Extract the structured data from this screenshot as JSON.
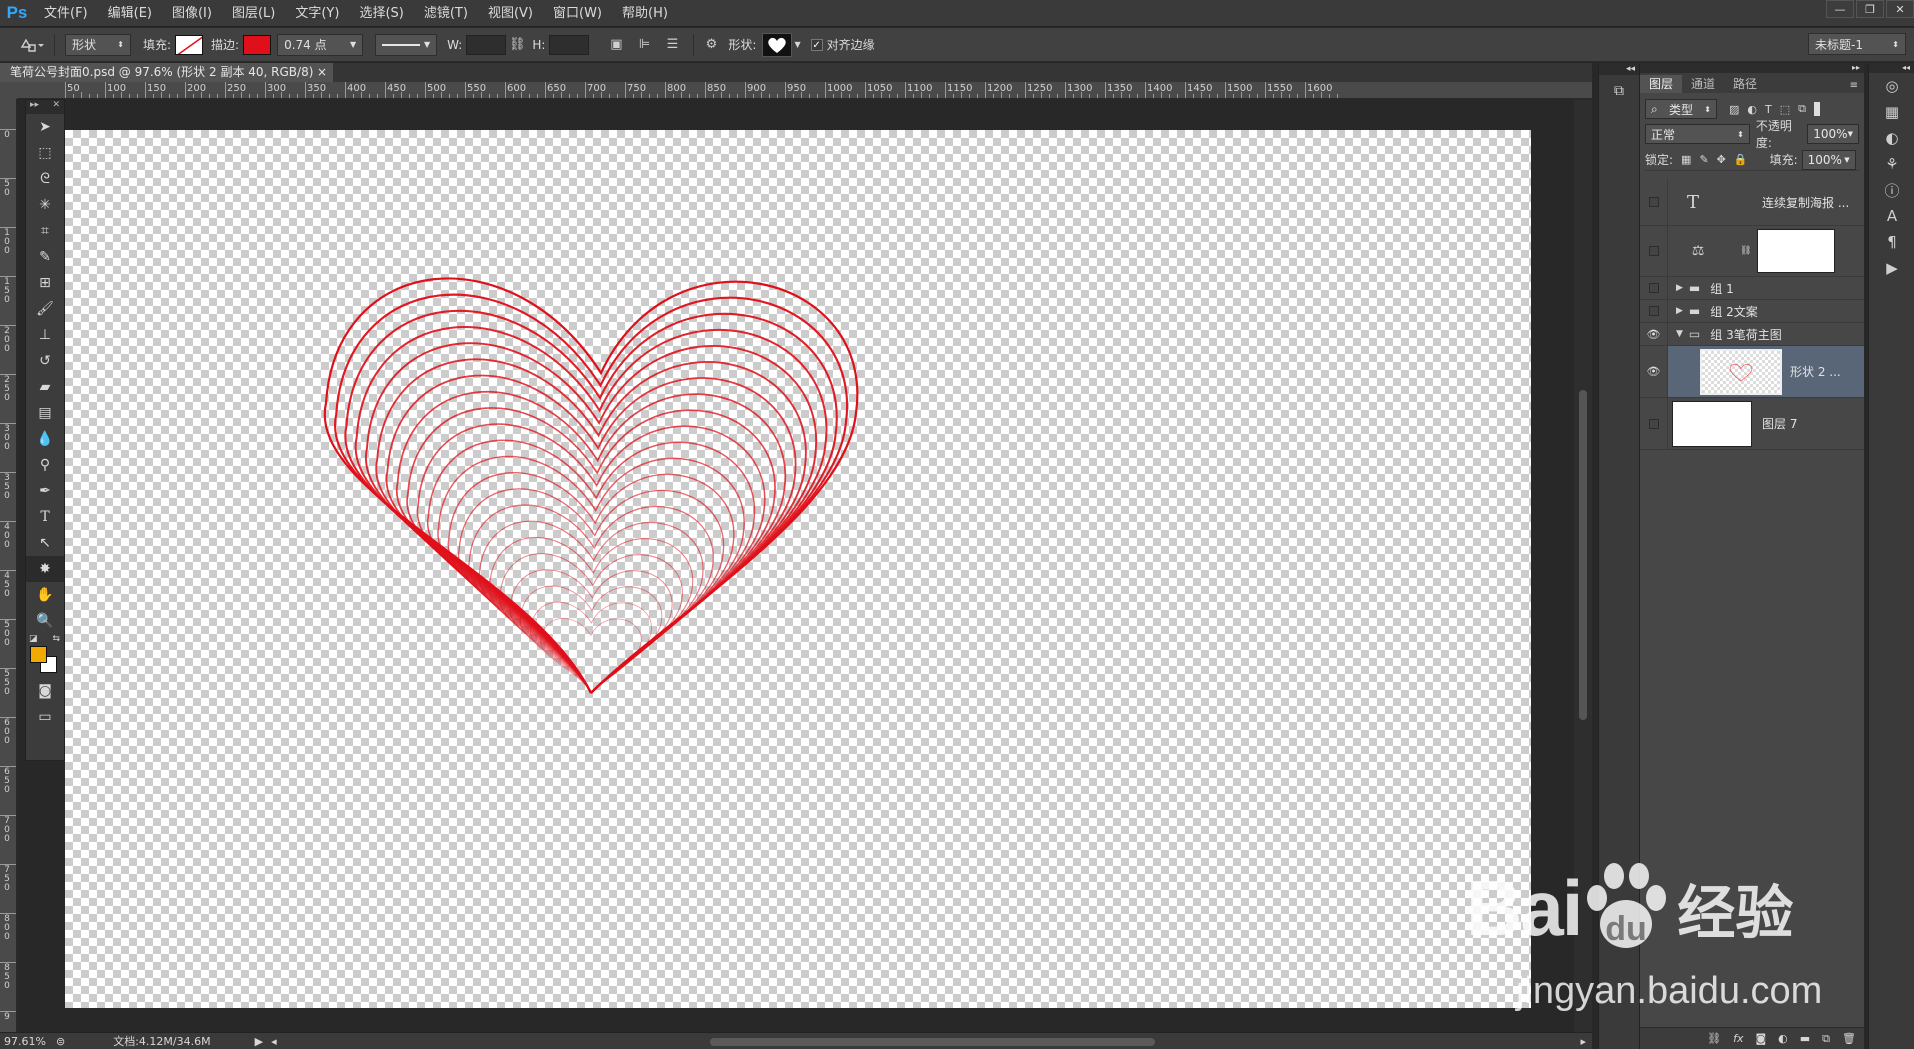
{
  "app": {
    "logo": "Ps"
  },
  "menu": [
    "文件(F)",
    "编辑(E)",
    "图像(I)",
    "图层(L)",
    "文字(Y)",
    "选择(S)",
    "滤镜(T)",
    "视图(V)",
    "窗口(W)",
    "帮助(H)"
  ],
  "window_controls": {
    "minimize": "—",
    "restore": "❐",
    "close": "✕"
  },
  "options": {
    "tool_mode": "形状",
    "fill_label": "填充:",
    "stroke_label": "描边:",
    "stroke_color": "#e0101a",
    "stroke_width": "0.74 点",
    "w_label": "W:",
    "h_label": "H:",
    "shape_label": "形状:",
    "align_edges_label": "对齐边缘",
    "workspace": "未标题-1"
  },
  "document": {
    "tab_title": "笔荷公号封面0.psd @ 97.6% (形状 2 副本 40, RGB/8) *",
    "tab_close": "×"
  },
  "ruler": {
    "h_labels": [
      "50",
      "100",
      "150",
      "200",
      "250",
      "300",
      "350",
      "400",
      "450",
      "500",
      "550",
      "600",
      "650",
      "700",
      "750",
      "800",
      "850",
      "900",
      "950",
      "1000",
      "1050",
      "1100",
      "1150",
      "1200",
      "1250",
      "1300",
      "1350",
      "1400",
      "1450",
      "1500",
      "1550",
      "1600"
    ],
    "v_labels": [
      "0",
      "5\n0",
      "1\n0\n0",
      "1\n5\n0",
      "2\n0\n0",
      "2\n5\n0",
      "3\n0\n0",
      "3\n5\n0",
      "4\n0\n0",
      "4\n5\n0",
      "5\n0\n0",
      "5\n5\n0",
      "6\n0\n0",
      "6\n5\n0",
      "7\n0\n0",
      "7\n5\n0",
      "8\n0\n0",
      "8\n5\n0",
      "9"
    ]
  },
  "colors": {
    "foreground": "#f2a900",
    "background": "#ffffff",
    "heart_stroke": "#e0101a",
    "selected_layer": "#596678"
  },
  "status": {
    "zoom": "97.61%",
    "doc_info": "文档:4.12M/34.6M"
  },
  "layers_panel": {
    "tabs": [
      "图层",
      "通道",
      "路径"
    ],
    "filter_kind": "类型",
    "blend_mode": "正常",
    "opacity_label": "不透明度:",
    "opacity": "100%",
    "lock_label": "锁定:",
    "fill_label": "填充:",
    "fill": "100%",
    "layers": [
      {
        "name": "连续复制海报 ...",
        "kind": "text",
        "visible": false
      },
      {
        "name": "",
        "kind": "adjustment",
        "visible": false
      },
      {
        "name": "组 1",
        "kind": "group",
        "visible": false,
        "expanded": false
      },
      {
        "name": "组 2文案",
        "kind": "group",
        "visible": false,
        "expanded": false
      },
      {
        "name": "组 3笔荷主图",
        "kind": "group",
        "visible": true,
        "expanded": true
      },
      {
        "name": "形状 2 ...",
        "kind": "shape",
        "visible": true,
        "selected": true
      },
      {
        "name": "图层 7",
        "kind": "pixel",
        "visible": false
      }
    ]
  },
  "watermark": {
    "brand": "Bai",
    "brand2": "经验",
    "url": "jingyan.baidu.com"
  }
}
